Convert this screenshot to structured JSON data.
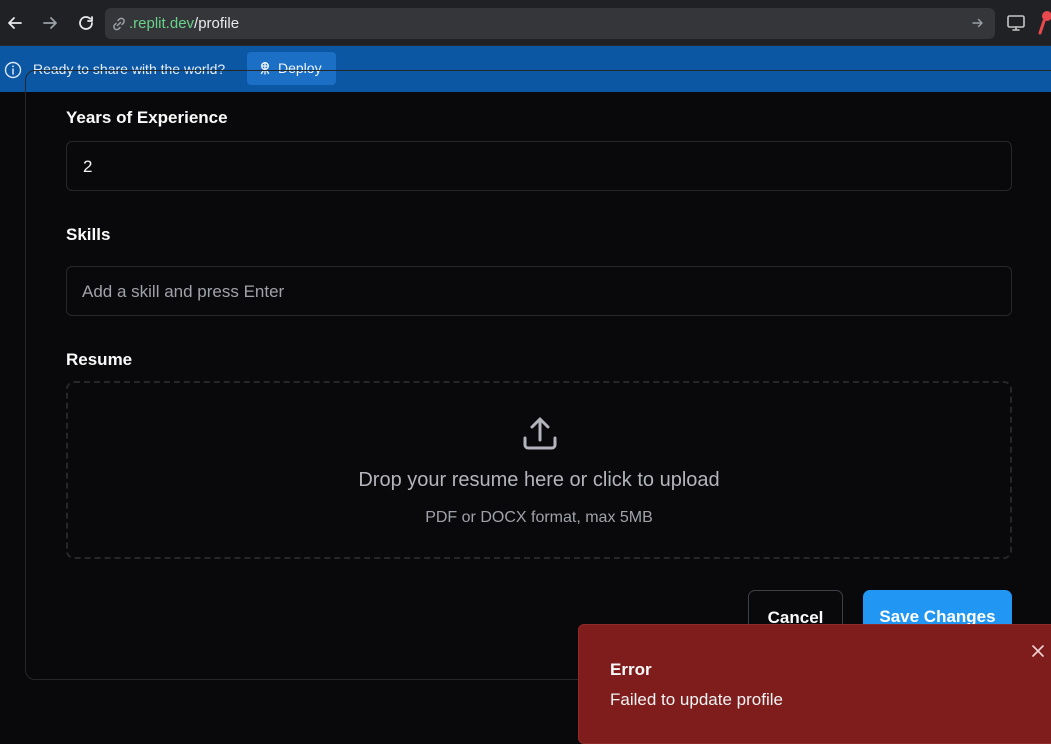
{
  "browser": {
    "url_host": ".replit.dev",
    "url_path": "/profile"
  },
  "banner": {
    "message": "Ready to share with the world?",
    "deploy_label": "Deploy"
  },
  "form": {
    "experience": {
      "label": "Years of Experience",
      "value": "2"
    },
    "skills": {
      "label": "Skills",
      "placeholder": "Add a skill and press Enter"
    },
    "resume": {
      "label": "Resume",
      "drop_title": "Drop your resume here or click to upload",
      "drop_hint": "PDF or DOCX format, max 5MB"
    },
    "cancel_label": "Cancel",
    "save_label": "Save Changes"
  },
  "toast": {
    "title": "Error",
    "message": "Failed to update profile"
  },
  "colors": {
    "page_bg": "#09090b",
    "banner_bg": "#0b57a4",
    "primary": "#2196f3",
    "error_bg": "#7f1d1d",
    "url_host": "#6ad18a"
  },
  "icons": [
    "back-arrow-icon",
    "forward-arrow-icon",
    "reload-icon",
    "link-icon",
    "go-arrow-icon",
    "monitor-icon",
    "extension-icon",
    "info-icon",
    "deploy-icon",
    "upload-icon",
    "close-icon"
  ]
}
